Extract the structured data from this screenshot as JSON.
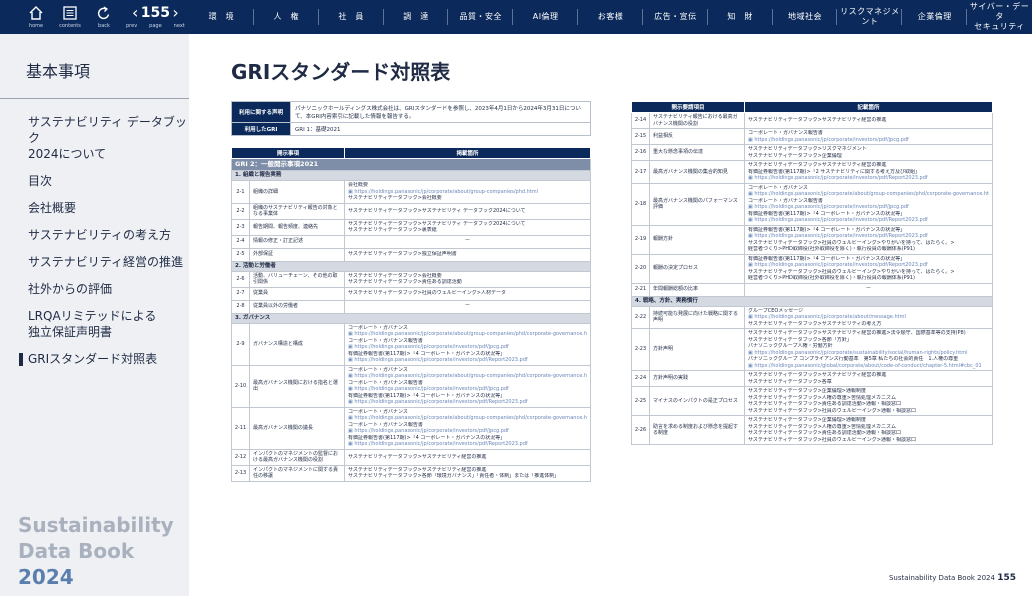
{
  "toolbar": {
    "home_label": "home",
    "contents_label": "contents",
    "back_label": "back",
    "page_number": "155",
    "prev_label": "prev",
    "page_label": "page",
    "next_label": "next"
  },
  "nav": [
    "環　境",
    "人　権",
    "社　員",
    "調　達",
    "品質・安全",
    "AI倫理",
    "お客様",
    "広告・宣伝",
    "知　財",
    "地域社会",
    "リスクマネジメント",
    "企業倫理",
    "サイバー・データ\nセキュリティ"
  ],
  "sidebar": {
    "title": "基本事項",
    "items": [
      {
        "label": "サステナビリティ データブック\n2024について",
        "active": false
      },
      {
        "label": "目次",
        "active": false
      },
      {
        "label": "会社概要",
        "active": false
      },
      {
        "label": "サステナビリティの考え方",
        "active": false
      },
      {
        "label": "サステナビリティ経営の推進",
        "active": false
      },
      {
        "label": "社外からの評価",
        "active": false
      },
      {
        "label": "LRQAリミテッドによる\n独立保証声明書",
        "active": false
      },
      {
        "label": "GRIスタンダード対照表",
        "active": true
      }
    ],
    "brand_line1": "Sustainability",
    "brand_line2": "Data Book",
    "brand_year": "2024"
  },
  "page_title": "GRIスタンダード対照表",
  "footer": {
    "text": "Sustainability Data Book 2024",
    "page": "155"
  },
  "info": [
    {
      "head": "利用に関する声明",
      "text": "パナソニックホールディングス株式会社は、GRIスタンダードを参照し、2023年4月1日から2024年3月31日について、本GRI内容索引に記載した情報を報告する。"
    },
    {
      "head": "利用したGRI",
      "text": "GRI 1：基礎2021"
    }
  ],
  "left_table": {
    "col1": "開示事項",
    "col2": "掲載箇所",
    "rows": [
      {
        "type": "gri2",
        "text": "GRI 2：一般開示事項2021"
      },
      {
        "type": "sec",
        "text": "1. 組織と報告実務"
      },
      {
        "type": "row",
        "no": "2-1",
        "item": "組織の詳細",
        "lines": [
          {
            "t": "会社概要"
          },
          {
            "t": "https://holdings.panasonic/jp/corporate/about/group-companies/phd.html",
            "url": true
          },
          {
            "t": "サステナビリティデータブック>会社概要"
          }
        ]
      },
      {
        "type": "row",
        "no": "2-2",
        "item": "組織のサステナビリティ報告の対象となる事業体",
        "lines": [
          {
            "t": "サステナビリティデータブック>サステナビリティ データブック2024について"
          }
        ]
      },
      {
        "type": "row",
        "no": "2-3",
        "item": "報告期間、報告頻度、連絡先",
        "lines": [
          {
            "t": "サステナビリティデータブック>サステナビリティ データブック2024について"
          },
          {
            "t": "サステナビリティデータブック>裏表紙"
          }
        ]
      },
      {
        "type": "row",
        "no": "2-4",
        "item": "情報の修正・訂正記述",
        "lines": [
          {
            "t": "ー",
            "dash": true
          }
        ]
      },
      {
        "type": "row",
        "no": "2-5",
        "item": "外部保証",
        "lines": [
          {
            "t": "サステナビリティデータブック>独立保証声明書"
          }
        ]
      },
      {
        "type": "sec",
        "text": "2. 活動と労働者"
      },
      {
        "type": "row",
        "no": "2-6",
        "item": "活動、バリューチェーン、その他の取引関係",
        "lines": [
          {
            "t": "サステナビリティデータブック>会社概要"
          },
          {
            "t": "サステナビリティデータブック>責任ある調達活動"
          }
        ]
      },
      {
        "type": "row",
        "no": "2-7",
        "item": "従業員",
        "lines": [
          {
            "t": "サステナビリティデータブック>社員のウェルビーイング>人材データ"
          }
        ]
      },
      {
        "type": "row",
        "no": "2-8",
        "item": "従業員以外の労働者",
        "lines": [
          {
            "t": "ー",
            "dash": true
          }
        ]
      },
      {
        "type": "sec",
        "text": "3. ガバナンス"
      },
      {
        "type": "row",
        "no": "2-9",
        "item": "ガバナンス構造と構成",
        "lines": [
          {
            "t": "コーポレート・ガバナンス"
          },
          {
            "t": "https://holdings.panasonic/jp/corporate/about/group-companies/phd/corporate-governance.html",
            "url": true
          },
          {
            "t": "コーポレート・ガバナンス報告書"
          },
          {
            "t": "https://holdings.panasonic/jp/corporate/investors/pdf/jpcg.pdf",
            "url": true
          },
          {
            "t": "有価証券報告書(第117期)>「4 コーポレート・ガバナンスの状況等」"
          },
          {
            "t": "https://holdings.panasonic/jp/corporate/investors/pdf/Report2023.pdf",
            "url": true
          }
        ]
      },
      {
        "type": "row",
        "no": "2-10",
        "item": "最高ガバナンス機関における指名と選出",
        "lines": [
          {
            "t": "コーポレート・ガバナンス"
          },
          {
            "t": "https://holdings.panasonic/jp/corporate/about/group-companies/phd/corporate-governance.html",
            "url": true
          },
          {
            "t": "コーポレート・ガバナンス報告書"
          },
          {
            "t": "https://holdings.panasonic/jp/corporate/investors/pdf/jpcg.pdf",
            "url": true
          },
          {
            "t": "有価証券報告書(第117期)>「4 コーポレート・ガバナンスの状況等」"
          },
          {
            "t": "https://holdings.panasonic/jp/corporate/investors/pdf/Report2023.pdf",
            "url": true
          }
        ]
      },
      {
        "type": "row",
        "no": "2-11",
        "item": "最高ガバナンス機関の議長",
        "lines": [
          {
            "t": "コーポレート・ガバナンス"
          },
          {
            "t": "https://holdings.panasonic/jp/corporate/about/group-companies/phd/corporate-governance.html",
            "url": true
          },
          {
            "t": "コーポレート・ガバナンス報告書"
          },
          {
            "t": "https://holdings.panasonic/jp/corporate/investors/pdf/jpcg.pdf",
            "url": true
          },
          {
            "t": "有価証券報告書(第117期)>「4 コーポレート・ガバナンスの状況等」"
          },
          {
            "t": "https://holdings.panasonic/jp/corporate/investors/pdf/Report2023.pdf",
            "url": true
          }
        ]
      },
      {
        "type": "row",
        "no": "2-12",
        "item": "インパクトのマネジメントの監督における最高ガバナンス機関の役割",
        "lines": [
          {
            "t": "サステナビリティデータブック>サステナビリティ経営の推進"
          }
        ]
      },
      {
        "type": "row",
        "no": "2-13",
        "item": "インパクトのマネジメントに関する責任の移譲",
        "lines": [
          {
            "t": "サステナビリティデータブック>サステナビリティ経営の推進"
          },
          {
            "t": "サステナビリティデータブック>各節「環境ガバナンス」「責任者・体制」または「推進体制」"
          }
        ]
      }
    ]
  },
  "right_table": {
    "col1": "開示要請項目",
    "col2": "記載箇所",
    "rows": [
      {
        "type": "row",
        "no": "2-14",
        "item": "サステナビリティ報告における最高ガバナンス機関の役割",
        "lines": [
          {
            "t": "サステナビリティデータブック>サステナビリティ経営の推進"
          }
        ]
      },
      {
        "type": "row",
        "no": "2-15",
        "item": "利益相反",
        "lines": [
          {
            "t": "コーポレート・ガバナンス報告書"
          },
          {
            "t": "https://holdings.panasonic/jp/corporate/investors/pdf/jpcg.pdf",
            "url": true
          }
        ]
      },
      {
        "type": "row",
        "no": "2-16",
        "item": "重大な懸念事項の伝達",
        "lines": [
          {
            "t": "サステナビリティデータブック>リスクマネジメント"
          },
          {
            "t": "サステナビリティデータブック>企業倫理"
          }
        ]
      },
      {
        "type": "row",
        "no": "2-17",
        "item": "最高ガバナンス機関の集合的知見",
        "lines": [
          {
            "t": "サステナビリティデータブック>サステナビリティ経営の推進"
          },
          {
            "t": "有価証券報告書(第117期)>「2 サステナビリティに関する考え方及び取組」"
          },
          {
            "t": "https://holdings.panasonic/jp/corporate/investors/pdf/Report2023.pdf",
            "url": true
          }
        ]
      },
      {
        "type": "row",
        "no": "2-18",
        "item": "最高ガバナンス機関のパフォーマンス評価",
        "lines": [
          {
            "t": "コーポレート・ガバナンス"
          },
          {
            "t": "https://holdings.panasonic/jp/corporate/about/group-companies/phd/corporate-governance.html",
            "url": true
          },
          {
            "t": "コーポレート・ガバナンス報告書"
          },
          {
            "t": "https://holdings.panasonic/jp/corporate/investors/pdf/jpcg.pdf",
            "url": true
          },
          {
            "t": "有価証券報告書(第117期)>「4 コーポレート・ガバナンスの状況等」"
          },
          {
            "t": "https://holdings.panasonic/jp/corporate/investors/pdf/Report2023.pdf",
            "url": true
          }
        ]
      },
      {
        "type": "row",
        "no": "2-19",
        "item": "報酬方針",
        "lines": [
          {
            "t": "有価証券報告書(第117期)>「4 コーポレート・ガバナンスの状況等」"
          },
          {
            "t": "https://holdings.panasonic/jp/corporate/investors/pdf/Report2023.pdf",
            "url": true
          },
          {
            "t": "サステナビリティデータブック>社員のウェルビーイング>やりがいを持って、はたらく。>"
          },
          {
            "t": "経営者づくり>PHD取締役(社外取締役を除く)・執行役員の報酬体系(P91)"
          }
        ]
      },
      {
        "type": "row",
        "no": "2-20",
        "item": "報酬の決定プロセス",
        "lines": [
          {
            "t": "有価証券報告書(第117期)>「4 コーポレート・ガバナンスの状況等」"
          },
          {
            "t": "https://holdings.panasonic/jp/corporate/investors/pdf/Report2023.pdf",
            "url": true
          },
          {
            "t": "サステナビリティデータブック>社員のウェルビーイング>やりがいを持って、はたらく。>"
          },
          {
            "t": "経営者づくり>PHD取締役(社外取締役を除く)・執行役員の報酬体系(P91)"
          }
        ]
      },
      {
        "type": "row",
        "no": "2-21",
        "item": "年間報酬総額の比率",
        "lines": [
          {
            "t": "ー",
            "dash": true
          }
        ]
      },
      {
        "type": "sec",
        "text": "4. 戦略、方針、実務慣行"
      },
      {
        "type": "row",
        "no": "2-22",
        "item": "持続可能な発展に向けた戦略に関する声明",
        "lines": [
          {
            "t": "グループCEOメッセージ"
          },
          {
            "t": "https://holdings.panasonic/jp/corporate/about/message.html",
            "url": true
          },
          {
            "t": "サステナビリティデータブック>サステナビリティの考え方"
          }
        ]
      },
      {
        "type": "row",
        "no": "2-23",
        "item": "方針声明",
        "lines": [
          {
            "t": "サステナビリティデータブック>サステナビリティ経営の推進>法令順守、国際基準等の支持(P8)"
          },
          {
            "t": "サステナビリティデータブック>各節「方針」"
          },
          {
            "t": "パナソニックグループ人権・労働方針"
          },
          {
            "t": "https://holdings.panasonic/jp/corporate/sustainability/social/human-rights/policy.html",
            "url": true
          },
          {
            "t": "パナソニックグループ コンプライアンス行動基準　第5章 私たちの社会的責任　1.人権の尊重"
          },
          {
            "t": "https://holdings.panasonic/global/corporate/about/code-of-conduct/chapter-5.html#cbc_01",
            "url": true
          }
        ]
      },
      {
        "type": "row",
        "no": "2-24",
        "item": "方針声明の実践",
        "lines": [
          {
            "t": "サステナビリティデータブック>サステナビリティ経営の推進"
          },
          {
            "t": "サステナビリティデータブック>各章"
          }
        ]
      },
      {
        "type": "row",
        "no": "2-25",
        "item": "マイナスのインパクトの是正プロセス",
        "lines": [
          {
            "t": "サステナビリティデータブック>企業倫理>通報制度"
          },
          {
            "t": "サステナビリティデータブック>人権の尊重>苦情処理メカニズム"
          },
          {
            "t": "サステナビリティデータブック>責任ある調達活動>通報・相談窓口"
          },
          {
            "t": "サステナビリティデータブック>社員のウェルビーイング>通報・相談窓口"
          }
        ]
      },
      {
        "type": "row",
        "no": "2-26",
        "item": "助言を求める制度および懸念を提起する制度",
        "lines": [
          {
            "t": "サステナビリティデータブック>企業倫理>通報制度"
          },
          {
            "t": "サステナビリティデータブック>人権の尊重>苦情処理メカニズム"
          },
          {
            "t": "サステナビリティデータブック>責任ある調達活動>通報・相談窓口"
          },
          {
            "t": "サステナビリティデータブック>社員のウェルビーイング>通報・相談窓口"
          }
        ]
      }
    ]
  }
}
